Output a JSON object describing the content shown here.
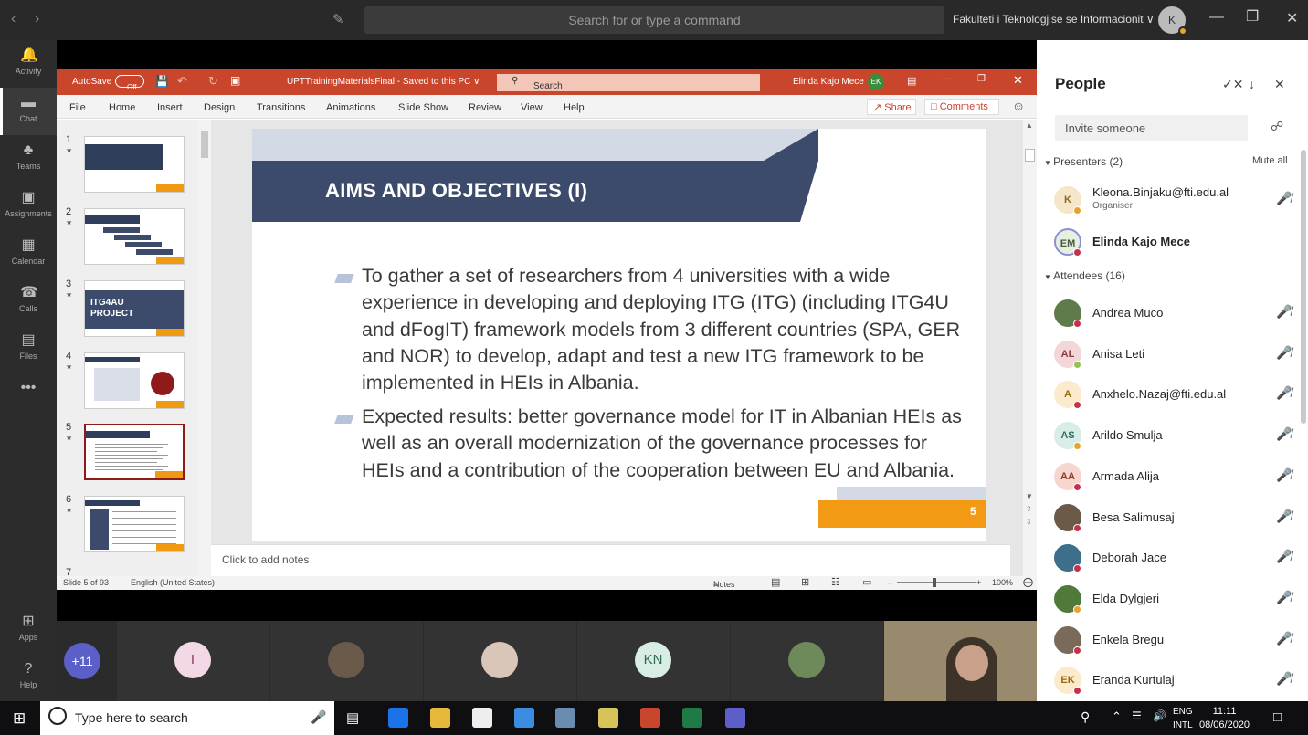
{
  "teams": {
    "search_placeholder": "Search for or type a command",
    "org": "Fakulteti i Teknologjise se Informacionit ∨",
    "me_initials": "K"
  },
  "rail": [
    {
      "label": "Activity",
      "icon": "bell-icon",
      "glyph": "🔔"
    },
    {
      "label": "Chat",
      "icon": "chat-icon",
      "glyph": "▬"
    },
    {
      "label": "Teams",
      "icon": "teams-icon",
      "glyph": "♣"
    },
    {
      "label": "Assignments",
      "icon": "assignments-icon",
      "glyph": "▣"
    },
    {
      "label": "Calendar",
      "icon": "calendar-icon",
      "glyph": "▦"
    },
    {
      "label": "Calls",
      "icon": "phone-icon",
      "glyph": "☎"
    },
    {
      "label": "Files",
      "icon": "files-icon",
      "glyph": "▤"
    },
    {
      "label": "",
      "icon": "more-icon",
      "glyph": "•••"
    },
    {
      "label": "Apps",
      "icon": "apps-icon",
      "glyph": "⊞"
    },
    {
      "label": "Help",
      "icon": "help-icon",
      "glyph": "?"
    }
  ],
  "powerpoint": {
    "autosave": "AutoSave",
    "autosave_state": "Off",
    "doc_title": "UPTTrainingMaterialsFinal  -  Saved to this PC  ∨",
    "search": "Search",
    "user": "Elinda Kajo Mece",
    "user_initials": "EK",
    "tabs": [
      "File",
      "Home",
      "Insert",
      "Design",
      "Transitions",
      "Animations",
      "Slide Show",
      "Review",
      "View",
      "Help"
    ],
    "share": "Share",
    "comments": "Comments",
    "thumb_numbers": [
      "1",
      "2",
      "3",
      "4",
      "5",
      "6",
      "7"
    ],
    "thumb3_text": "ITG4AU PROJECT",
    "notes_placeholder": "Click to add notes",
    "status": {
      "slide": "Slide 5 of 93",
      "language": "English (United States)",
      "notes": "Notes",
      "zoom": "100%"
    }
  },
  "slide": {
    "title": "AIMS AND OBJECTIVES (I)",
    "bullets": [
      "To gather a set of researchers from 4 universities with a wide experience in developing and deploying ITG (ITG) (including ITG4U and dFogIT) framework models from 3 different countries (SPA, GER and NOR) to develop, adapt and test a new ITG framework to be implemented in HEIs in Albania.",
      "Expected results: better governance model for IT in Albanian HEIs as well as an overall modernization of the governance processes for HEIs and a contribution of the cooperation between EU and Albania."
    ],
    "number": "5"
  },
  "people": {
    "title": "People",
    "invite_placeholder": "Invite someone",
    "presenters_label": "Presenters (2)",
    "mute_all": "Mute all",
    "presenters": [
      {
        "initials": "K",
        "name": "Kleona.Binjaku@fti.edu.al",
        "role": "Organiser",
        "bg": "#f6e6c8",
        "fg": "#8a6a2a",
        "status": "#e3a530"
      },
      {
        "initials": "EM",
        "name": "Elinda Kajo Mece",
        "role": "",
        "bg": "#e6efe0",
        "fg": "#4a5a40",
        "status": "#c4314b"
      }
    ],
    "attendees_label": "Attendees (16)",
    "attendees": [
      {
        "initials": "",
        "name": "Andrea Muco",
        "bg": "#5f7a4b",
        "fg": "#fff",
        "status": "#c4314b"
      },
      {
        "initials": "AL",
        "name": "Anisa Leti",
        "bg": "#f3d6d8",
        "fg": "#8b3a44",
        "status": "#92c353"
      },
      {
        "initials": "A",
        "name": "Anxhelo.Nazaj@fti.edu.al",
        "bg": "#fbeacc",
        "fg": "#9a6a10",
        "status": "#c4314b"
      },
      {
        "initials": "AS",
        "name": "Arildo Smulja",
        "bg": "#d8ede8",
        "fg": "#2f6b5c",
        "status": "#e3a530"
      },
      {
        "initials": "AA",
        "name": "Armada Alija",
        "bg": "#f6d6cf",
        "fg": "#8f3b2a",
        "status": "#c4314b"
      },
      {
        "initials": "",
        "name": "Besa Salimusaj",
        "bg": "#6c5a48",
        "fg": "#fff",
        "status": "#c4314b"
      },
      {
        "initials": "",
        "name": "Deborah Jace",
        "bg": "#3d6f8a",
        "fg": "#fff",
        "status": "#c4314b"
      },
      {
        "initials": "",
        "name": "Elda Dylgjeri",
        "bg": "#4f7a3a",
        "fg": "#fff",
        "status": "#e3a530"
      },
      {
        "initials": "",
        "name": "Enkela Bregu",
        "bg": "#7a6a5a",
        "fg": "#fff",
        "status": "#c4314b"
      },
      {
        "initials": "EK",
        "name": "Eranda Kurtulaj",
        "bg": "#fbeacc",
        "fg": "#9a6a10",
        "status": "#c4314b"
      }
    ]
  },
  "video": {
    "overflow": "+11",
    "tiles": [
      {
        "label": "I",
        "bg": "#f3d9e6",
        "fg": "#8b3a66"
      },
      {
        "label": "",
        "bg": "#6a5a4a",
        "fg": "#fff"
      },
      {
        "label": "",
        "bg": "#d9c6b8",
        "fg": "#fff"
      },
      {
        "label": "KN",
        "bg": "#d8ede4",
        "fg": "#2f6b4c"
      },
      {
        "label": "",
        "bg": "#6e8a5a",
        "fg": "#fff"
      }
    ]
  },
  "taskbar": {
    "search": "Type here to search",
    "lang1": "ENG",
    "lang2": "INTL",
    "time": "11:11",
    "date": "08/06/2020"
  }
}
